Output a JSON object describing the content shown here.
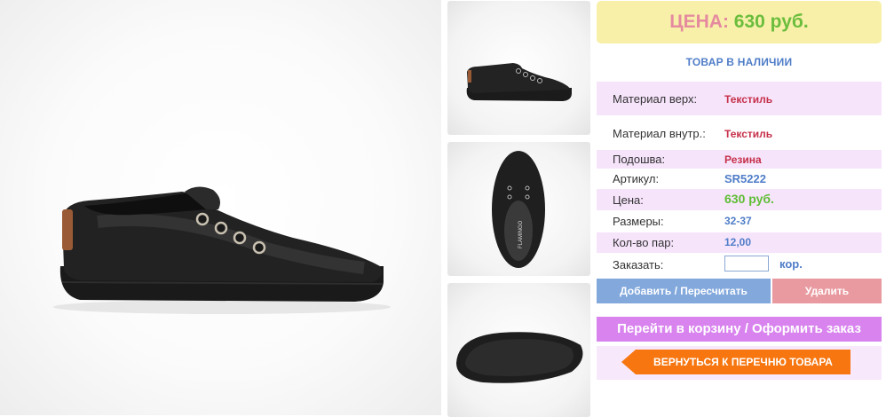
{
  "gallery": {
    "main_image": "black-canvas-slip-on-shoe-side-view",
    "thumbnails": [
      "shoe-side-view-thumbnail",
      "shoe-top-view-thumbnail",
      "shoe-sole-view-thumbnail"
    ],
    "insole_brand": "FLAMINGO"
  },
  "price_box": {
    "label": "ЦЕНА:",
    "value": "630 руб."
  },
  "stock_status": "ТОВАР В НАЛИЧИИ",
  "specs": [
    {
      "label": "Материал верх:",
      "value": "Текстиль"
    },
    {
      "label": "Материал внутр.:",
      "value": "Текстиль"
    },
    {
      "label": "Подошва:",
      "value": "Резина"
    },
    {
      "label": "Артикул:",
      "value": "SR5222"
    },
    {
      "label": "Цена:",
      "value": "630 руб."
    },
    {
      "label": "Размеры:",
      "value": "32-37"
    },
    {
      "label": "Кол-во пар:",
      "value": "12,00"
    }
  ],
  "order": {
    "label": "Заказать:",
    "value": "",
    "unit": "кор."
  },
  "buttons": {
    "add": "Добавить / Пересчитать",
    "delete": "Удалить",
    "cart": "Перейти в корзину / Оформить заказ",
    "back": "ВЕРНУТЬСЯ К ПЕРЕЧНЮ ТОВАРА"
  },
  "colors": {
    "price_bg": "#f8f0a9",
    "price_label": "#e58a9f",
    "price_value": "#6bbd3d",
    "stock": "#4f7dc8",
    "row_highlight": "#f6e4fb",
    "add_button": "#82a8dc",
    "delete_button": "#e99aa0",
    "cart_button": "#d983ef",
    "back_button": "#f7760f"
  }
}
